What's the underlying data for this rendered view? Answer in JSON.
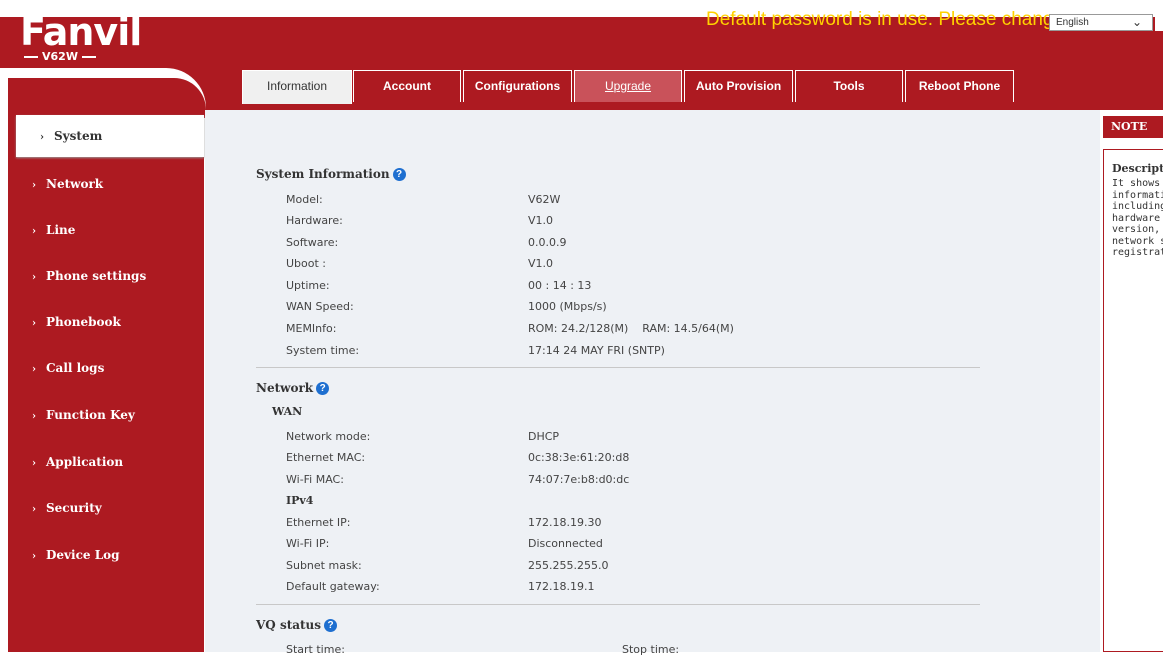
{
  "header": {
    "logo": "Fanvil",
    "model": "V62W",
    "warning": "Default password is in use. Please change",
    "language": "English"
  },
  "tabs": [
    {
      "label": "Information"
    },
    {
      "label": "Account"
    },
    {
      "label": "Configurations"
    },
    {
      "label": "Upgrade"
    },
    {
      "label": "Auto Provision"
    },
    {
      "label": "Tools"
    },
    {
      "label": "Reboot Phone"
    }
  ],
  "sidebar": {
    "items": [
      {
        "label": "System"
      },
      {
        "label": "Network"
      },
      {
        "label": "Line"
      },
      {
        "label": "Phone settings"
      },
      {
        "label": "Phonebook"
      },
      {
        "label": "Call logs"
      },
      {
        "label": "Function Key"
      },
      {
        "label": "Application"
      },
      {
        "label": "Security"
      },
      {
        "label": "Device Log"
      }
    ]
  },
  "system_info": {
    "title": "System Information",
    "rows": [
      {
        "label": "Model:",
        "value": "V62W"
      },
      {
        "label": "Hardware:",
        "value": "V1.0"
      },
      {
        "label": "Software:",
        "value": "0.0.0.9"
      },
      {
        "label": "Uboot :",
        "value": "V1.0"
      },
      {
        "label": "Uptime:",
        "value": "00 : 14 : 13"
      },
      {
        "label": "WAN Speed:",
        "value": "1000 (Mbps/s)"
      },
      {
        "label": "MEMInfo:",
        "value": "ROM: 24.2/128(M)    RAM: 14.5/64(M)"
      },
      {
        "label": "System time:",
        "value": "17:14 24 MAY FRI (SNTP)"
      }
    ]
  },
  "network": {
    "title": "Network",
    "wan_title": "WAN",
    "wan_rows": [
      {
        "label": "Network mode:",
        "value": "DHCP"
      },
      {
        "label": "Ethernet MAC:",
        "value": "0c:38:3e:61:20:d8"
      },
      {
        "label": "Wi-Fi MAC:",
        "value": "74:07:7e:b8:d0:dc"
      }
    ],
    "ipv4_title": "IPv4",
    "ipv4_rows": [
      {
        "label": "Ethernet IP:",
        "value": "172.18.19.30"
      },
      {
        "label": "Wi-Fi IP:",
        "value": "Disconnected"
      },
      {
        "label": "Subnet mask:",
        "value": "255.255.255.0"
      },
      {
        "label": "Default gateway:",
        "value": "172.18.19.1"
      }
    ]
  },
  "vq_status": {
    "title": "VQ status",
    "start_label": "Start time:",
    "stop_label": "Stop time:"
  },
  "note": {
    "head": "NOTE",
    "title": "Descript",
    "lines": [
      "It shows",
      "informati",
      "including",
      "hardware",
      "version, r",
      "network s",
      "registrati"
    ]
  }
}
